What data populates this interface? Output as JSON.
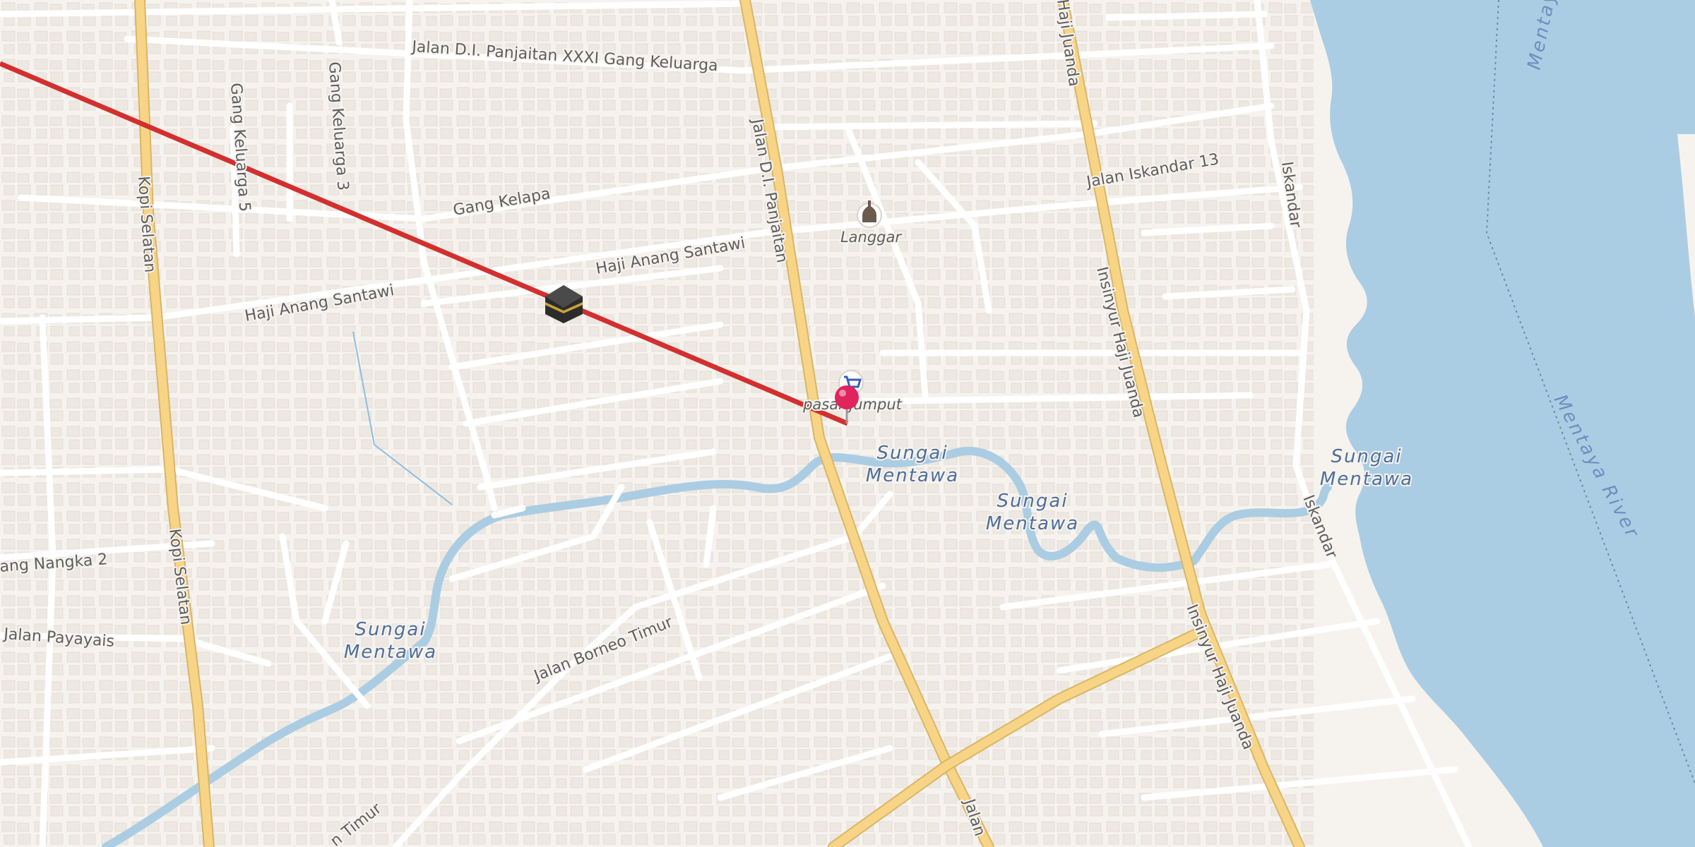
{
  "map": {
    "streets": [
      {
        "id": "panjaitan-xxxi",
        "label": "Jalan D.I. Panjaitan XXXI Gang Keluarga"
      },
      {
        "id": "gang-kelapa",
        "label": "Gang Kelapa"
      },
      {
        "id": "haji-anang-santawi-1",
        "label": "Haji Anang Santawi"
      },
      {
        "id": "haji-anang-santawi-2",
        "label": "Haji Anang Santawi"
      },
      {
        "id": "jalan-di-panjaitan",
        "label": "Jalan D.I. Panjaitan"
      },
      {
        "id": "jalan-iskandar-13",
        "label": "Jalan Iskandar 13"
      },
      {
        "id": "iskandar-1",
        "label": "Iskandar"
      },
      {
        "id": "iskandar-2",
        "label": "Iskandar"
      },
      {
        "id": "haji-juanda-top",
        "label": "Haji Juanda"
      },
      {
        "id": "insinyur-haji-juanda-1",
        "label": "Insinyur Haji Juanda"
      },
      {
        "id": "insinyur-haji-juanda-2",
        "label": "Insinyur Haji Juanda"
      },
      {
        "id": "kopi-selatan-1",
        "label": "Kopi Selatan"
      },
      {
        "id": "kopi-selatan-2",
        "label": "Kopi Selatan"
      },
      {
        "id": "gang-keluarga-5",
        "label": "Gang Keluarga 5"
      },
      {
        "id": "gang-keluarga-3",
        "label": "Gang Keluarga 3"
      },
      {
        "id": "gang-nangka-2",
        "label": "ang Nangka 2"
      },
      {
        "id": "jalan-payayais",
        "label": "Jalan Payayais"
      },
      {
        "id": "jalan-borneo-timur",
        "label": "Jalan Borneo Timur"
      },
      {
        "id": "timur-bottom",
        "label": "n Timur"
      },
      {
        "id": "jalan-bottom",
        "label": "Jalan"
      }
    ],
    "water": [
      {
        "id": "sungai-mentawa-1",
        "line1": "Sungai",
        "line2": "Mentawa"
      },
      {
        "id": "sungai-mentawa-2",
        "line1": "Sungai",
        "line2": "Mentawa"
      },
      {
        "id": "sungai-mentawa-3",
        "line1": "Sungai",
        "line2": "Mentawa"
      },
      {
        "id": "sungai-mentawa-4",
        "line1": "Sungai",
        "line2": "Mentawa"
      }
    ],
    "river": {
      "label": "Mentaya River",
      "label_top": "Mentay"
    },
    "pois": {
      "langgar": {
        "label": "Langgar",
        "icon": "mosque-icon"
      },
      "pasar": {
        "label": "pasar jumput",
        "icon": "shopping-cart-icon"
      },
      "kaaba": {
        "icon": "kaaba-icon"
      }
    },
    "marker": {
      "icon": "location-pin-icon",
      "color": "#e0245e"
    },
    "route": {
      "color": "#d32f2f"
    },
    "colors": {
      "land": "#f6f3ef",
      "water": "#abcde3",
      "major_road": "#f7d486",
      "minor_road": "#ffffff",
      "building": "#e9e2da"
    }
  }
}
